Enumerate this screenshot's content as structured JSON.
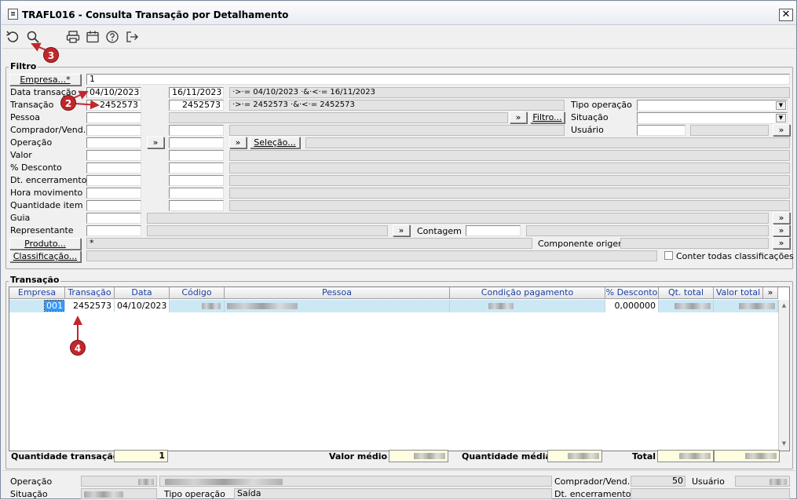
{
  "window": {
    "title": "TRAFL016 - Consulta Transação por Detalhamento",
    "close": "✕"
  },
  "toolbar": [
    "undo-icon",
    "search-icon",
    "print-icon",
    "calendar-icon",
    "help-icon",
    "exit-icon"
  ],
  "markers": {
    "m2": "2",
    "m3": "3",
    "m4": "4"
  },
  "filtro": {
    "title": "Filtro",
    "empresa_btn": "Empresa...*",
    "empresa_val": "1",
    "labels": {
      "data_transacao": "Data transação",
      "transacao": "Transação",
      "pessoa": "Pessoa",
      "comprador": "Comprador/Vend.",
      "operacao": "Operação",
      "valor": "Valor",
      "desconto": "% Desconto",
      "dt_encerramento": "Dt. encerramento",
      "hora_movimento": "Hora movimento",
      "quantidade_item": "Quantidade item",
      "guia": "Guia",
      "representante": "Representante",
      "tipo_operacao": "Tipo operação",
      "situacao": "Situação",
      "usuario": "Usuário",
      "contagem": "Contagem",
      "componente_origem": "Componente origem",
      "conter_todas": "Conter todas classificações"
    },
    "data_ini": "04/10/2023",
    "data_fim": "16/11/2023",
    "data_expr": "·>·= 04/10/2023 ·&·<·= 16/11/2023",
    "trans_ini": "2452573",
    "trans_fim": "2452573",
    "trans_expr": "·>·= 2452573 ·&·<·= 2452573",
    "filtro_btn": "Filtro...",
    "selecao_btn": "Seleção...",
    "produto_btn": "Produto...",
    "produto_val": "*",
    "classificacao_btn": "Classificação...",
    "more": "»"
  },
  "transacao": {
    "title": "Transação",
    "columns": [
      "Empresa",
      "Transação",
      "Data",
      "Código",
      "Pessoa",
      "Condição pagamento",
      "% Desconto",
      "Qt. total",
      "Valor total"
    ],
    "row": {
      "empresa": "001",
      "transacao": "2452573",
      "data": "04/10/2023",
      "desconto": "0,000000"
    }
  },
  "totals": {
    "qtd_transacao_label": "Quantidade transação",
    "qtd_transacao": "1",
    "valor_medio_label": "Valor médio",
    "qtd_media_label": "Quantidade média",
    "total_label": "Total"
  },
  "bottom": {
    "operacao": "Operação",
    "situacao": "Situação",
    "tipo_operacao": "Tipo operação",
    "tipo_operacao_val": "Saída",
    "comprador": "Comprador/Vend.",
    "comprador_val": "50",
    "usuario": "Usuário",
    "dt_encerramento": "Dt. encerramento"
  }
}
